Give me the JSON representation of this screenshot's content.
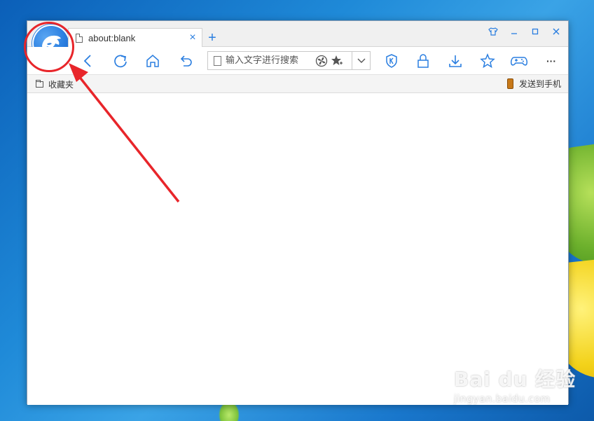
{
  "tab": {
    "title": "about:blank",
    "close": "×"
  },
  "new_tab": "+",
  "address": {
    "placeholder": "输入文字进行搜索"
  },
  "favorites": {
    "label": "收藏夹"
  },
  "send_to_phone": {
    "label": "发送到手机"
  },
  "more": "···",
  "watermark": {
    "brand": "Bai du 经验",
    "url": "jingyan.baidu.com"
  },
  "colors": {
    "accent": "#2a7ee0",
    "annotation": "#e8252a"
  }
}
